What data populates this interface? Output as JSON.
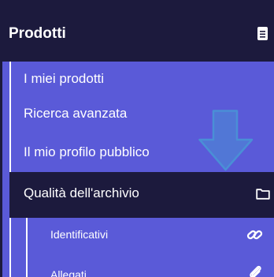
{
  "menu": {
    "header": {
      "title": "Prodotti",
      "icon": "menu-list-icon"
    },
    "items": [
      {
        "label": "I miei prodotti"
      },
      {
        "label": "Ricerca avanzata"
      },
      {
        "label": "Il mio profilo pubblico"
      },
      {
        "label": "Qualità dell'archivio",
        "icon": "folder-icon",
        "active": true
      }
    ],
    "subitems": [
      {
        "label": "Identificativi",
        "icon": "link-icon"
      },
      {
        "label": "Allegati",
        "icon": "paperclip-icon"
      }
    ]
  },
  "annotation": {
    "arrow_icon": "down-arrow-icon",
    "arrow_color": "#4a8fd6"
  },
  "colors": {
    "sidebar_bg": "#5a5ad8",
    "header_bg": "#1c1a3d",
    "text": "#ffffff"
  }
}
